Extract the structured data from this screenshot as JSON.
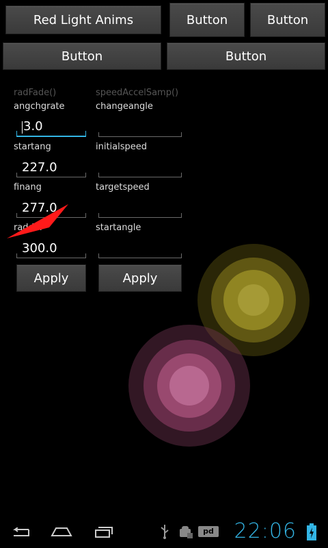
{
  "top_buttons": {
    "row1": [
      "Red Light Anims",
      "Button",
      "Button"
    ],
    "row2": [
      "Button",
      "Button"
    ]
  },
  "left_column": {
    "hint": "radFade()",
    "fields": [
      {
        "label": "angchgrate",
        "value": "3.0"
      },
      {
        "label": "startang",
        "value": "227.0"
      },
      {
        "label": "finang",
        "value": "277.0"
      },
      {
        "label": "raddiff",
        "value": "300.0"
      }
    ],
    "apply_label": "Apply"
  },
  "right_column": {
    "hint": "speedAccelSamp()",
    "fields": [
      {
        "label": "changeangle",
        "value": ""
      },
      {
        "label": "initialspeed",
        "value": ""
      },
      {
        "label": "targetspeed",
        "value": ""
      },
      {
        "label": "startangle",
        "value": ""
      }
    ],
    "apply_label": "Apply"
  },
  "status_bar": {
    "time": "22:06",
    "icons": [
      "usb-icon",
      "android-debug-icon",
      "pd-icon",
      "battery-charging-icon"
    ]
  },
  "nav_bar": {
    "icons": [
      "back-icon",
      "home-icon",
      "recent-apps-icon"
    ]
  },
  "colors": {
    "accent": "#33b5e5",
    "red_shape": "#ff1a1a",
    "yellow_glow": "#b8a83a",
    "pink_glow": "#c06a8a"
  }
}
